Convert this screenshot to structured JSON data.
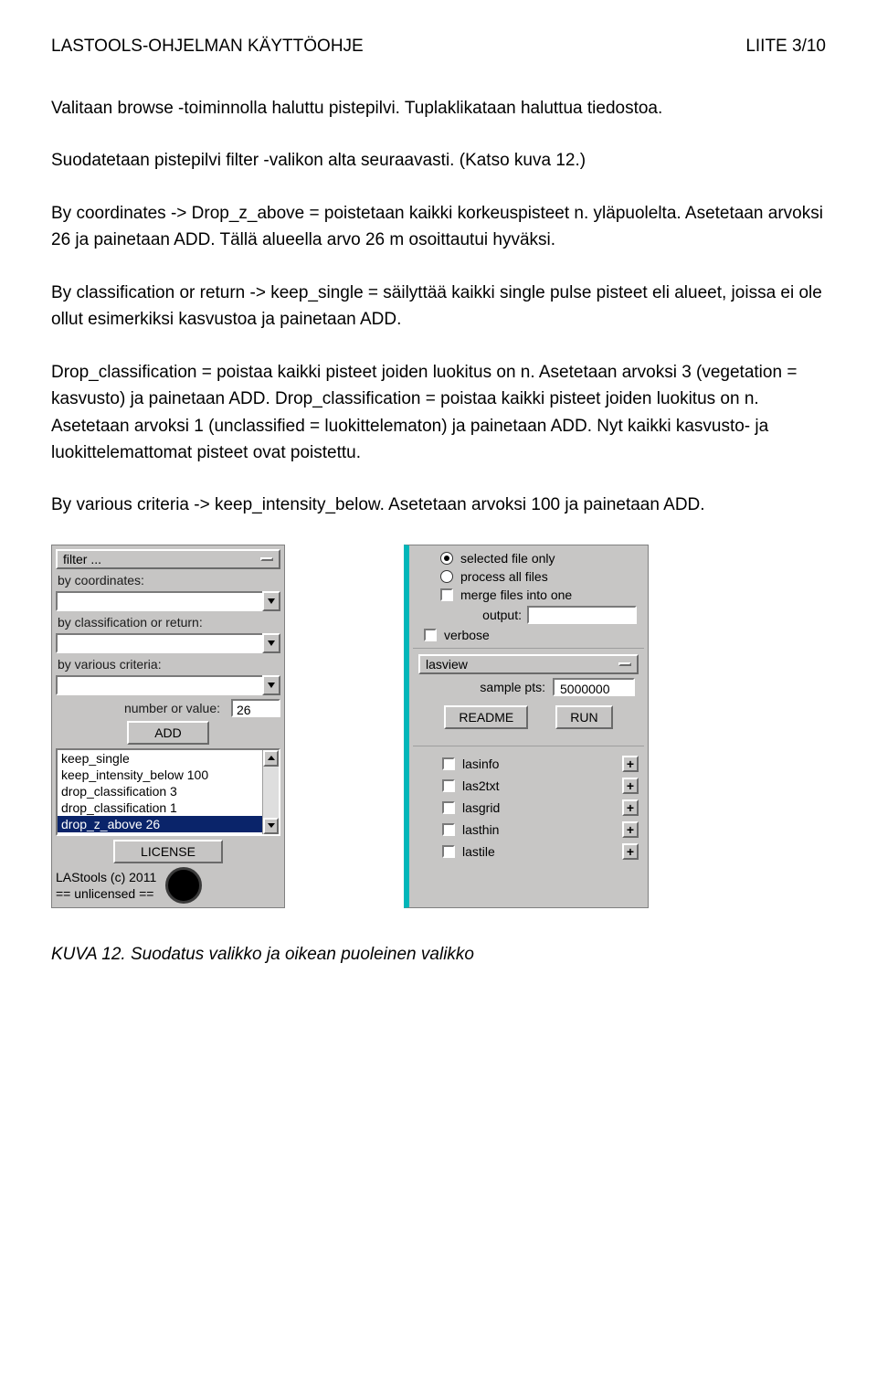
{
  "header": {
    "left": "LASTOOLS-OHJELMAN KÄYTTÖOHJE",
    "right": "LIITE 3/10"
  },
  "paragraphs": {
    "p1": "Valitaan browse -toiminnolla haluttu pistepilvi. Tuplaklikataan haluttua tiedostoa.",
    "p2": "Suodatetaan pistepilvi filter -valikon alta seuraavasti. (Katso kuva 12.)",
    "p3": "By coordinates -> Drop_z_above = poistetaan kaikki korkeuspisteet n. yläpuolelta. Asetetaan arvoksi 26 ja painetaan ADD. Tällä alueella arvo 26 m osoittautui hyväksi.",
    "p4": "By classification or return -> keep_single = säilyttää kaikki single pulse pisteet eli alueet,  joissa ei ole ollut esimerkiksi kasvustoa ja painetaan ADD.",
    "p5": "Drop_classification = poistaa kaikki pisteet joiden luokitus on n. Asetetaan arvoksi 3 (vegetation = kasvusto) ja painetaan ADD. Drop_classification = poistaa kaikki pisteet joiden luokitus on n. Asetetaan arvoksi 1 (unclassified = luokittelematon) ja painetaan ADD. Nyt kaikki kasvusto- ja luokittelemattomat pisteet ovat poistettu.",
    "p6": "By various criteria -> keep_intensity_below. Asetetaan arvoksi 100 ja painetaan ADD."
  },
  "left_panel": {
    "filter_label": "filter ...",
    "sections": {
      "by_coordinates": "by coordinates:",
      "by_classification": "by classification or return:",
      "by_various": "by various criteria:"
    },
    "number_label": "number or value:",
    "number_value": "26",
    "add_button": "ADD",
    "list_items": [
      "keep_single",
      "keep_intensity_below 100",
      "drop_classification 3",
      "drop_classification 1",
      "drop_z_above 26"
    ],
    "selected_index": 4,
    "license_button": "LICENSE",
    "license_line1": "LAStools (c) 2011",
    "license_line2": "== unlicensed =="
  },
  "right_panel": {
    "radio_selected": "selected file only",
    "radio_all": "process all files",
    "merge": "merge files into one",
    "output_label": "output:",
    "verbose": "verbose",
    "tool_name": "lasview",
    "sample_label": "sample pts:",
    "sample_value": "5000000",
    "readme": "README",
    "run": "RUN",
    "tools": [
      "lasinfo",
      "las2txt",
      "lasgrid",
      "lasthin",
      "lastile"
    ]
  },
  "caption": "KUVA 12. Suodatus valikko ja oikean puoleinen valikko"
}
